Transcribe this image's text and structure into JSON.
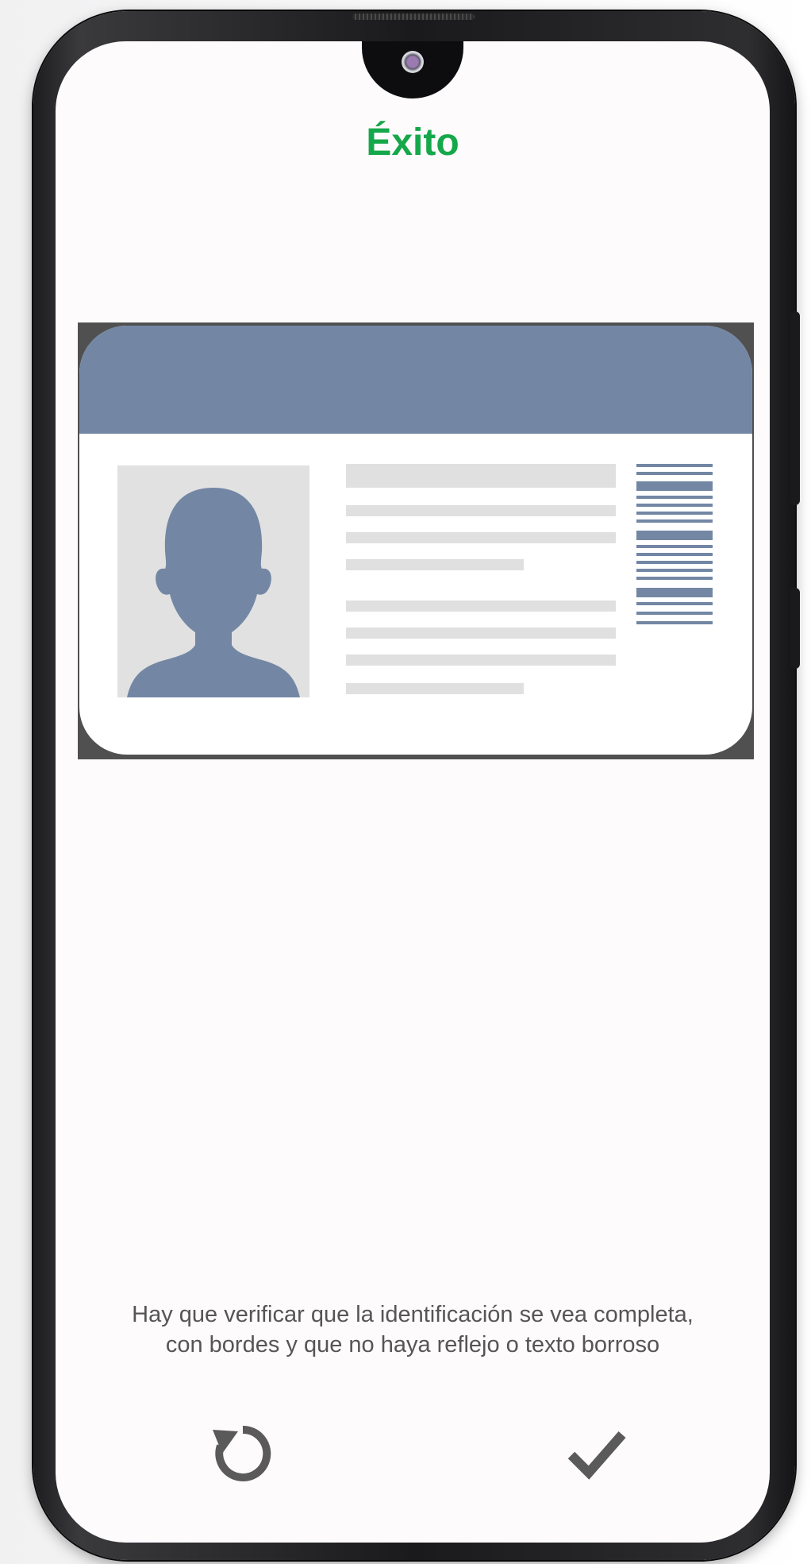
{
  "screen": {
    "title": "Éxito",
    "instruction_line1": "Hay que verificar que la identificación se vea completa,",
    "instruction_line2": "con bordes y que no haya reflejo o texto borroso"
  },
  "actions": {
    "retry_icon": "retry-icon",
    "confirm_icon": "checkmark-icon"
  },
  "id_card": {
    "photo_icon": "person-silhouette-icon",
    "barcode_icon": "barcode-icon"
  },
  "colors": {
    "title": "#15a84a",
    "card_accent": "#7387a4",
    "instruction_text": "#555555",
    "icon": "#5a5a5a"
  }
}
